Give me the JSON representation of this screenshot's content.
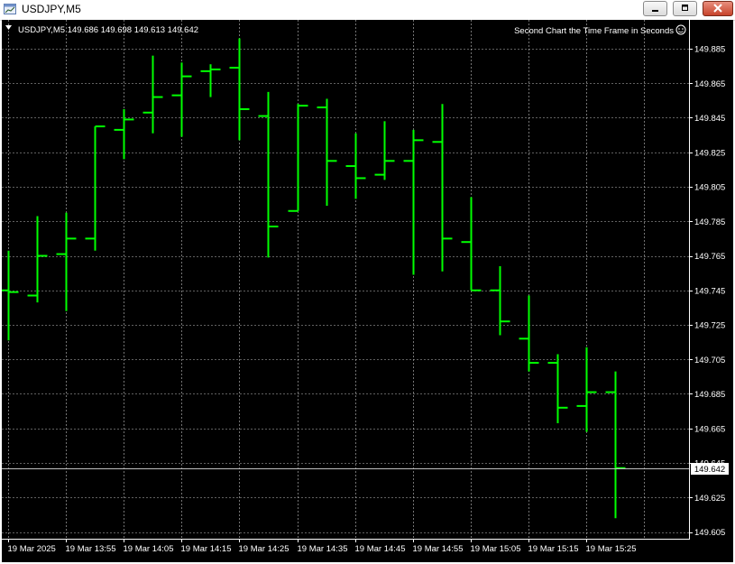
{
  "window": {
    "title": "USDJPY,M5",
    "app_icon": "chart-window-icon",
    "buttons": [
      "minimize-icon",
      "restore-icon",
      "close-icon"
    ]
  },
  "chart": {
    "header": "USDJPY,M5  149.686 149.698 149.613 149.642",
    "indicator_caption": "Second Chart the Time Frame in Seconds",
    "indicator_icon": "smiley-icon",
    "current_price_label": "149.642",
    "background": "#000000",
    "bar_color": "#00ff00",
    "grid_color": "#c0c0c0",
    "axis_color": "#ffffff"
  },
  "chart_data": {
    "type": "ohlc",
    "symbol": "USDJPY",
    "timeframe": "M5",
    "grid": true,
    "y_ticks": [
      "149.885",
      "149.865",
      "149.845",
      "149.825",
      "149.805",
      "149.785",
      "149.765",
      "149.745",
      "149.725",
      "149.705",
      "149.685",
      "149.665",
      "149.645",
      "149.625",
      "149.605"
    ],
    "ylim": [
      149.6,
      149.89
    ],
    "x_ticks": [
      {
        "label": "19 Mar 2025",
        "bar": 0
      },
      {
        "label": "19 Mar 13:55",
        "bar": 2
      },
      {
        "label": "19 Mar 14:05",
        "bar": 4
      },
      {
        "label": "19 Mar 14:15",
        "bar": 6
      },
      {
        "label": "19 Mar 14:25",
        "bar": 8
      },
      {
        "label": "19 Mar 14:35",
        "bar": 10
      },
      {
        "label": "19 Mar 14:45",
        "bar": 12
      },
      {
        "label": "19 Mar 14:55",
        "bar": 14
      },
      {
        "label": "19 Mar 15:05",
        "bar": 16
      },
      {
        "label": "19 Mar 15:15",
        "bar": 18
      },
      {
        "label": "19 Mar 15:25",
        "bar": 20
      }
    ],
    "current_price": 149.642,
    "bars": [
      {
        "o": 149.745,
        "h": 149.768,
        "l": 149.716,
        "c": 149.744
      },
      {
        "o": 149.742,
        "h": 149.788,
        "l": 149.738,
        "c": 149.765
      },
      {
        "o": 149.766,
        "h": 149.79,
        "l": 149.733,
        "c": 149.775
      },
      {
        "o": 149.775,
        "h": 149.84,
        "l": 149.768,
        "c": 149.84
      },
      {
        "o": 149.838,
        "h": 149.85,
        "l": 149.821,
        "c": 149.844
      },
      {
        "o": 149.848,
        "h": 149.881,
        "l": 149.836,
        "c": 149.857
      },
      {
        "o": 149.858,
        "h": 149.877,
        "l": 149.834,
        "c": 149.869
      },
      {
        "o": 149.872,
        "h": 149.876,
        "l": 149.857,
        "c": 149.873
      },
      {
        "o": 149.874,
        "h": 149.891,
        "l": 149.832,
        "c": 149.85
      },
      {
        "o": 149.846,
        "h": 149.86,
        "l": 149.764,
        "c": 149.782
      },
      {
        "o": 149.791,
        "h": 149.853,
        "l": 149.791,
        "c": 149.852
      },
      {
        "o": 149.851,
        "h": 149.856,
        "l": 149.794,
        "c": 149.82
      },
      {
        "o": 149.817,
        "h": 149.836,
        "l": 149.798,
        "c": 149.81
      },
      {
        "o": 149.812,
        "h": 149.843,
        "l": 149.809,
        "c": 149.82
      },
      {
        "o": 149.82,
        "h": 149.838,
        "l": 149.754,
        "c": 149.832
      },
      {
        "o": 149.831,
        "h": 149.853,
        "l": 149.756,
        "c": 149.775
      },
      {
        "o": 149.773,
        "h": 149.799,
        "l": 149.745,
        "c": 149.745
      },
      {
        "o": 149.745,
        "h": 149.759,
        "l": 149.719,
        "c": 149.727
      },
      {
        "o": 149.717,
        "h": 149.742,
        "l": 149.698,
        "c": 149.703
      },
      {
        "o": 149.703,
        "h": 149.708,
        "l": 149.668,
        "c": 149.677
      },
      {
        "o": 149.678,
        "h": 149.712,
        "l": 149.663,
        "c": 149.686
      },
      {
        "o": 149.686,
        "h": 149.698,
        "l": 149.613,
        "c": 149.642
      }
    ]
  }
}
